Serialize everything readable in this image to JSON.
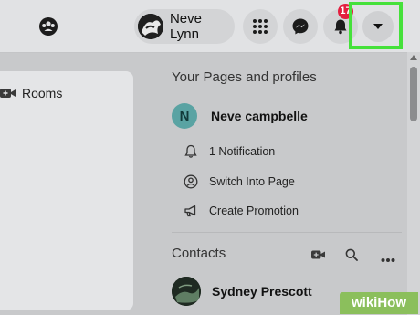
{
  "topbar": {
    "profile_name": "Neve Lynn",
    "notification_count": "17"
  },
  "left_panel": {
    "rooms_label": "Rooms"
  },
  "right_panel": {
    "pages_title": "Your Pages and profiles",
    "page": {
      "avatar_letter": "N",
      "name": "Neve campbelle"
    },
    "page_actions": [
      {
        "label": "1 Notification",
        "icon": "bell-icon"
      },
      {
        "label": "Switch Into Page",
        "icon": "switch-profile-icon"
      },
      {
        "label": "Create Promotion",
        "icon": "megaphone-icon"
      }
    ],
    "contacts_title": "Contacts",
    "contacts": [
      {
        "name": "Sydney Prescott"
      }
    ]
  },
  "watermark": "wikiHow",
  "colors": {
    "highlight": "#45e13a",
    "badge": "#e41e3f",
    "page_avatar": "#5aa3a3"
  }
}
